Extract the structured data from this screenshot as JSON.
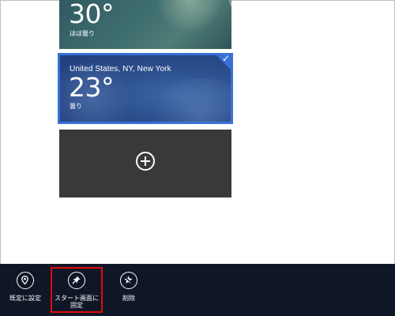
{
  "tiles": {
    "top": {
      "temp": "30°",
      "condition": "ほぼ曇り"
    },
    "selected": {
      "location": "United States, NY, New York",
      "temp": "23°",
      "condition": "曇り"
    },
    "add": {
      "icon": "plus-circle-icon"
    }
  },
  "appbar": {
    "commands": [
      {
        "label": "既定に設定",
        "icon": "location-pin-icon"
      },
      {
        "label": "スタート画面に固定",
        "icon": "pin-icon"
      },
      {
        "label": "削除",
        "icon": "remove-star-icon"
      }
    ]
  },
  "colors": {
    "selection_accent": "#3a6fd8",
    "appbar_bg": "#0f1626",
    "add_tile_bg": "#393939",
    "highlight": "#e00a0a"
  }
}
